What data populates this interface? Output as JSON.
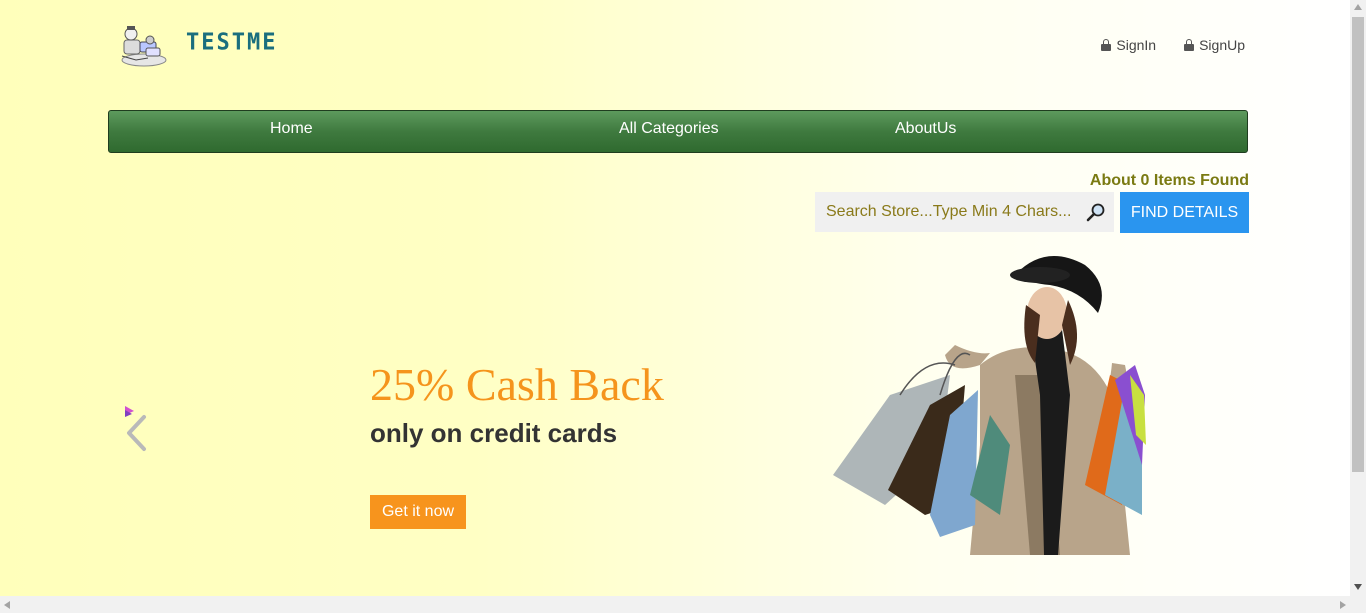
{
  "brand": {
    "name": "TESTME",
    "logo_icon": "robot-logo-icon"
  },
  "top_links": [
    {
      "label": "SignIn",
      "icon": "lock-icon"
    },
    {
      "label": "SignUp",
      "icon": "lock-icon"
    }
  ],
  "nav": {
    "items": [
      "Home",
      "All Categories",
      "AboutUs"
    ]
  },
  "search": {
    "results_text": "About 0 Items Found",
    "placeholder": "Search Store...Type Min 4 Chars...",
    "value": "",
    "button_label": "FIND DETAILS",
    "icon": "search-icon"
  },
  "carousel": {
    "title": "25% Cash Back",
    "subtitle": "only on credit cards",
    "cta_label": "Get it now",
    "prev_icon": "chevron-left-icon",
    "image": "shopping-woman-image"
  },
  "colors": {
    "nav": "#3f7a3f",
    "find_button": "#2a95ef",
    "cta": "#f7941d",
    "title": "#f5941c",
    "brand": "#1a6e7e",
    "results_text": "#7a7a12"
  }
}
